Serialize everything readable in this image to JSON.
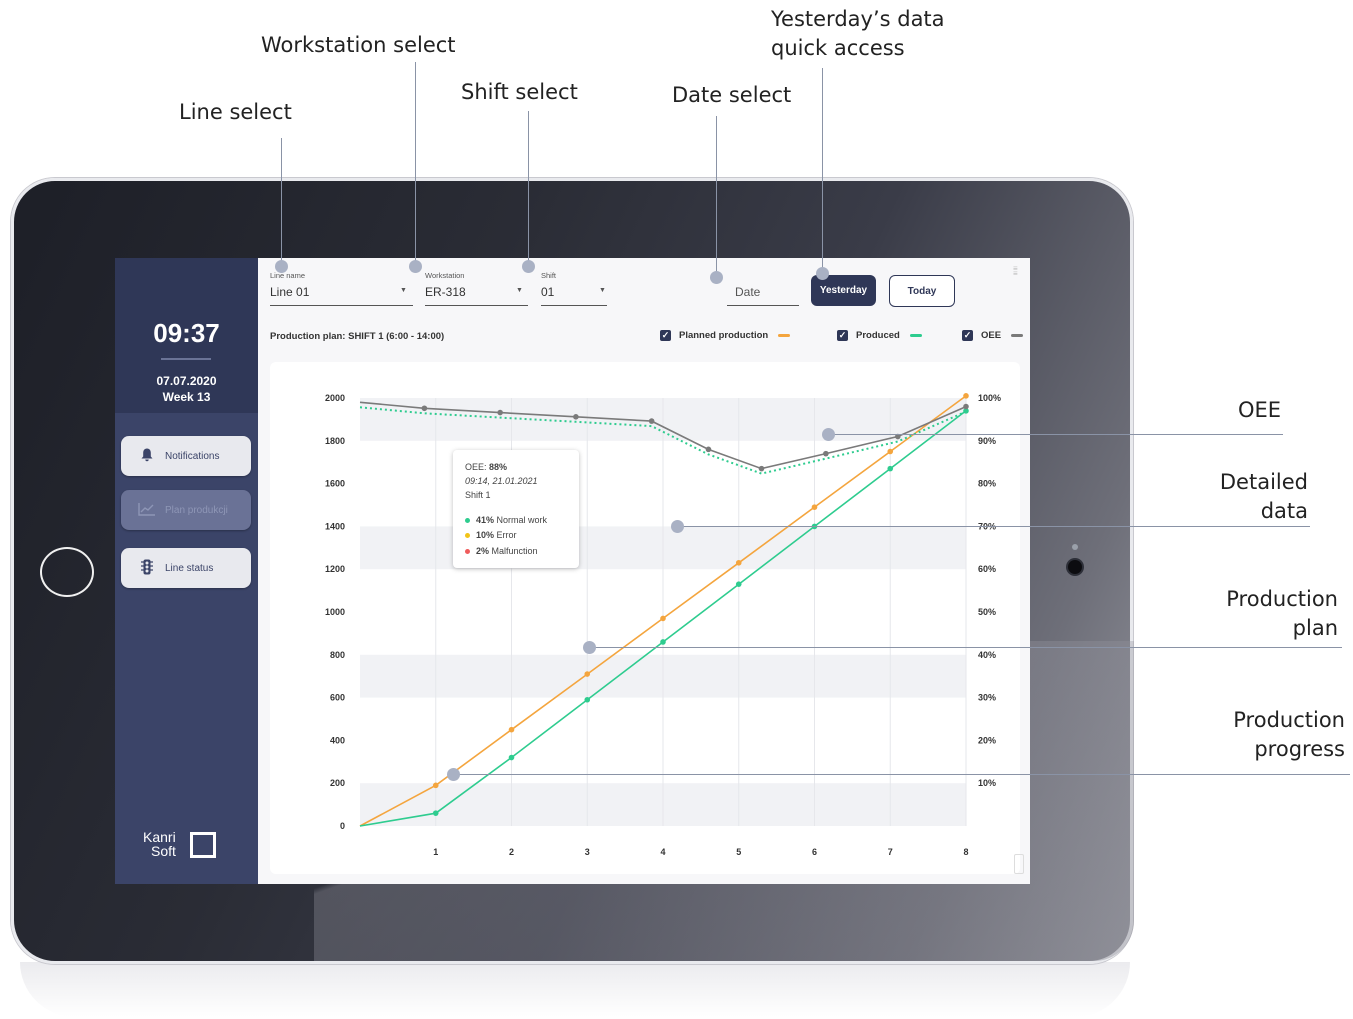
{
  "annotations": {
    "line_select": "Line select",
    "workstation_select": "Workstation select",
    "shift_select": "Shift select",
    "date_select": "Date select",
    "yesterday_line1": "Yesterday’s data",
    "yesterday_line2": "quick access",
    "oee": "OEE",
    "detailed_line1": "Detailed",
    "detailed_line2": "data",
    "plan_line1": "Production",
    "plan_line2": "plan",
    "progress_line1": "Production",
    "progress_line2": "progress"
  },
  "sidebar": {
    "time": "09:37",
    "date": "07.07.2020",
    "week": "Week 13",
    "buttons": {
      "notifications": "Notifications",
      "plan": "Plan produkcji",
      "line_status": "Line status"
    },
    "logo_top": "Kanri",
    "logo_bottom": "Soft"
  },
  "filters": {
    "line": {
      "label": "Line name",
      "value": "Line 01"
    },
    "workstation": {
      "label": "Workstation",
      "value": "ER-318"
    },
    "shift": {
      "label": "Shift",
      "value": "01"
    },
    "date": {
      "placeholder": "Date"
    },
    "yesterday": "Yesterday",
    "today": "Today"
  },
  "plan_title": "Production plan: SHIFT 1 (6:00 - 14:00)",
  "legend": {
    "planned": "Planned production",
    "produced": "Produced",
    "oee": "OEE"
  },
  "colors": {
    "planned": "#f4a53e",
    "produced": "#2ecc8f",
    "oee": "#7a7a7a",
    "sidebar": "#3b4468",
    "accent": "#2f3757"
  },
  "tooltip": {
    "oee_label": "OEE:",
    "oee_value": "88%",
    "timestamp": "09:14, 21.01.2021",
    "shift": "Shift 1",
    "normal_pct": "41%",
    "normal_label": "Normal work",
    "error_pct": "10%",
    "error_label": "Error",
    "malf_pct": "2%",
    "malf_label": "Malfunction",
    "dot_colors": [
      "#2ecc8f",
      "#f2c418",
      "#ef5b5b"
    ]
  },
  "chart_data": {
    "type": "line",
    "x": [
      0,
      1,
      2,
      3,
      4,
      5,
      6,
      7,
      8
    ],
    "x_ticks": [
      "1",
      "2",
      "3",
      "4",
      "5",
      "6",
      "7",
      "8"
    ],
    "y_ticks": [
      "2000",
      "1800",
      "1600",
      "1400",
      "1200",
      "1000",
      "800",
      "600",
      "400",
      "200",
      "0"
    ],
    "y2_ticks": [
      "100%",
      "90%",
      "80%",
      "70%",
      "60%",
      "50%",
      "40%",
      "30%",
      "20%",
      "10%"
    ],
    "ylim": [
      0,
      2000
    ],
    "y2lim": [
      0,
      100
    ],
    "series": [
      {
        "name": "Planned production",
        "axis": "left",
        "values": [
          0,
          190,
          450,
          710,
          970,
          1230,
          1490,
          1750,
          2010
        ]
      },
      {
        "name": "Produced",
        "axis": "left",
        "values": [
          0,
          60,
          320,
          590,
          860,
          1130,
          1400,
          1670,
          1940
        ]
      },
      {
        "name": "OEE",
        "axis": "right",
        "x": [
          0,
          0.85,
          1.85,
          2.85,
          3.85,
          4.6,
          5.3,
          6.15,
          7.1,
          8
        ],
        "values": [
          99,
          97.6,
          96.6,
          95.6,
          94.6,
          88,
          83.5,
          87,
          91,
          98
        ]
      }
    ]
  }
}
